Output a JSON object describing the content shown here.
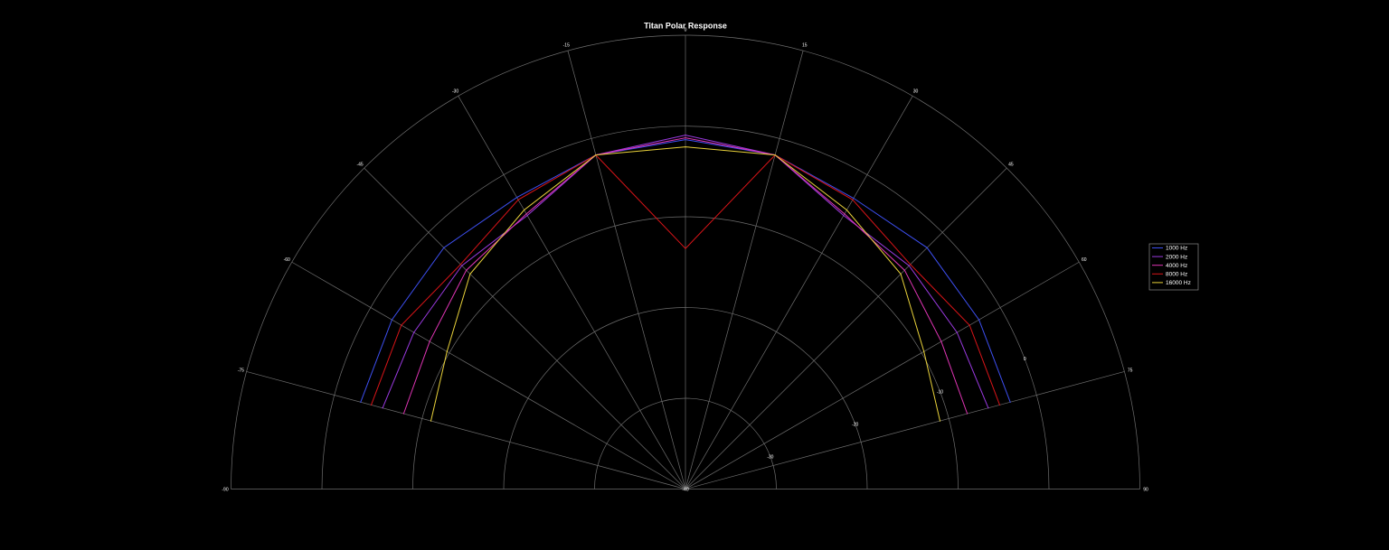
{
  "chart_data": {
    "type": "line",
    "coordinate_system": "polar",
    "title": "Titan Polar Response",
    "angle_range": [
      -90,
      90
    ],
    "angle_ticks": [
      -90,
      -75,
      -60,
      -45,
      -30,
      -15,
      0,
      15,
      30,
      45,
      60,
      75,
      90
    ],
    "angle_tick_labels": [
      "-90",
      "-75",
      "-60",
      "-45",
      "-30",
      "-15",
      "0",
      "15",
      "30",
      "45",
      "60",
      "75",
      "90"
    ],
    "radial_range": [
      -40,
      10
    ],
    "radial_ticks": [
      -40,
      -30,
      -20,
      -10,
      0,
      10
    ],
    "radial_tick_labels": [
      "-40",
      "-30",
      "-20",
      "-10",
      "0"
    ],
    "grid": true,
    "legend_position": "right",
    "angles": [
      -75,
      -60,
      -45,
      -30,
      -15,
      0,
      15,
      30,
      45,
      60,
      75
    ],
    "series": [
      {
        "name": "1000 Hz",
        "color": "#3d4ff0",
        "values": [
          -3.0,
          -2.7,
          -2.4,
          -2.9,
          -1.9,
          -1.5,
          -1.9,
          -3.0,
          -2.4,
          -2.7,
          -3.0
        ]
      },
      {
        "name": "2000 Hz",
        "color": "#9a3ae0",
        "values": [
          -5.5,
          -5.5,
          -5.2,
          -5.2,
          -1.9,
          -1.0,
          -1.9,
          -5.2,
          -5.2,
          -5.5,
          -5.5
        ]
      },
      {
        "name": "4000 Hz",
        "color": "#e035b5",
        "values": [
          -7.9,
          -7.5,
          -5.9,
          -5.0,
          -1.9,
          -1.3,
          -1.9,
          -5.0,
          -5.9,
          -7.5,
          -7.9
        ]
      },
      {
        "name": "8000 Hz",
        "color": "#d81418",
        "values": [
          -4.2,
          -3.9,
          -5.0,
          -3.2,
          -1.9,
          -13.5,
          -1.9,
          -3.2,
          -5.0,
          -3.9,
          -4.2
        ]
      },
      {
        "name": "16000 Hz",
        "color": "#e8d13a",
        "values": [
          -11.0,
          -9.7,
          -6.5,
          -4.5,
          -1.9,
          -2.3,
          -1.9,
          -4.5,
          -6.5,
          -9.7,
          -11.0
        ]
      }
    ]
  }
}
